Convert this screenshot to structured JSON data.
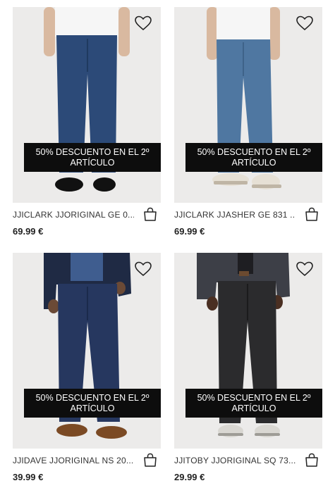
{
  "promo": {
    "line1": "50% DESCUENTO EN EL 2º",
    "line2": "ARTÍCULO"
  },
  "products": [
    {
      "name": "JJICLARK JJORIGINAL GE 0...",
      "price": "69.99 €",
      "denim_color": "#2c4a78",
      "shirt_color": "#f4f4f4",
      "shoe": "black-boots"
    },
    {
      "name": "JJICLARK JJASHER GE 831 ...",
      "price": "69.99 €",
      "denim_color": "#4f77a1",
      "shirt_color": "#f4f4f4",
      "shoe": "sneakers"
    },
    {
      "name": "JJIDAVE JJORIGINAL NS 20...",
      "price": "39.99 €",
      "denim_color": "#26375f",
      "shirt_color": "#2f3f63",
      "shoe": "brown-boots"
    },
    {
      "name": "JJITOBY JJORIGINAL SQ 73...",
      "price": "29.99 €",
      "denim_color": "#2b2b2d",
      "shirt_color": "#3b3d44",
      "shoe": "sneakers"
    }
  ],
  "icons": {
    "wishlist": "heart-outline-icon",
    "add_to_bag": "shopping-bag-icon"
  },
  "colors": {
    "promo_background": "#0d0d0d",
    "promo_text": "#ffffff",
    "photo_background": "#ededec"
  }
}
